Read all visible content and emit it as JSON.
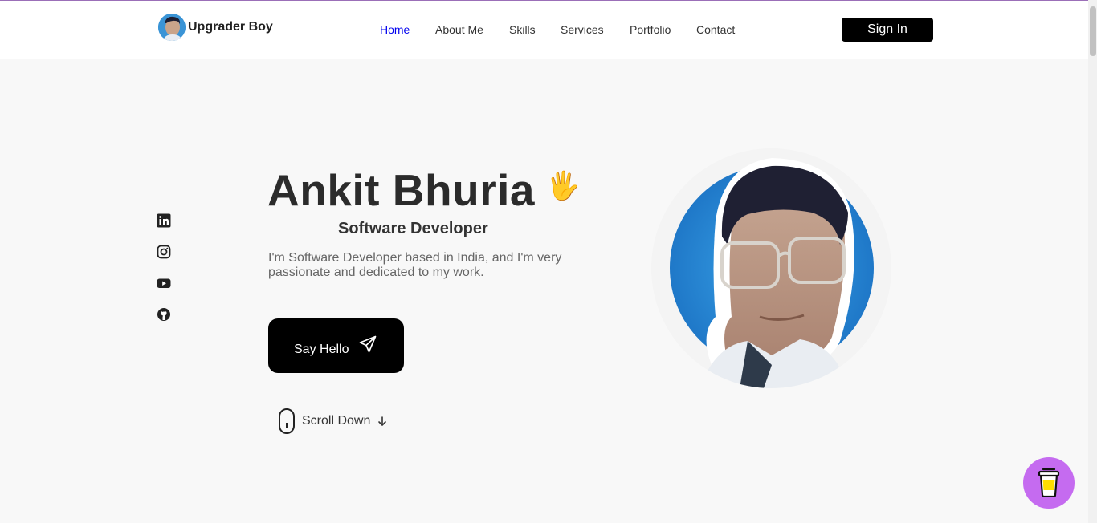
{
  "brand": {
    "name": "Upgrader Boy",
    "avatar_icon": "profile-photo"
  },
  "nav": {
    "items": [
      {
        "label": "Home",
        "active": true
      },
      {
        "label": "About Me",
        "active": false
      },
      {
        "label": "Skills",
        "active": false
      },
      {
        "label": "Services",
        "active": false
      },
      {
        "label": "Portfolio",
        "active": false
      },
      {
        "label": "Contact",
        "active": false
      }
    ]
  },
  "header": {
    "signin_label": "Sign In"
  },
  "social": [
    "linkedin-icon",
    "instagram-icon",
    "youtube-icon",
    "github-icon"
  ],
  "hero": {
    "name": "Ankit Bhuria",
    "wave_emoji": "🖐",
    "role": "Software Developer",
    "description": "I'm Software Developer based in India, and I'm very passionate and dedicated to my work.",
    "cta_label": "Say Hello",
    "scroll_label": "Scroll Down"
  },
  "colors": {
    "accent_link": "#0000ee",
    "button_bg": "#000000",
    "coffee_button": "#c56bf0",
    "portrait_ring": "#2f8fd8"
  }
}
